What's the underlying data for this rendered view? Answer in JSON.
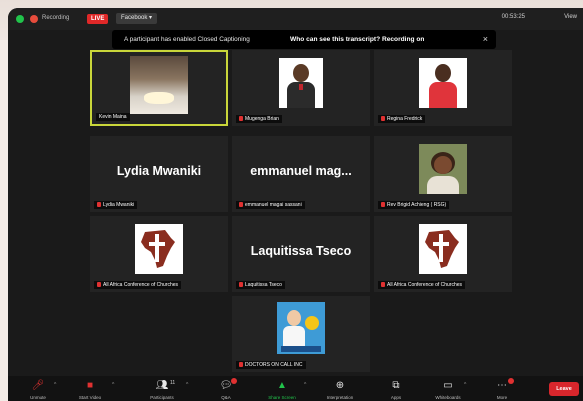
{
  "topbar": {
    "recording_text": "Recording",
    "live_badge": "LIVE",
    "platform": "Facebook ▾",
    "timer": "00:53:25",
    "view_label": "View"
  },
  "caption_banner": {
    "message": "A participant has enabled Closed Captioning",
    "link": "Who can see this transcript? Recording on",
    "close": "×"
  },
  "tiles": [
    {
      "id": "kevin",
      "label": "Kevin Maina"
    },
    {
      "id": "mugenga",
      "label": "Mugenga Brian"
    },
    {
      "id": "regina",
      "label": "Regina Fredrick"
    },
    {
      "id": "lydia",
      "label": "Lydia Mwaniki",
      "big": "Lydia Mwaniki"
    },
    {
      "id": "emmanuel",
      "label": "emmanuel magai sassani",
      "big": "emmanuel  mag..."
    },
    {
      "id": "rev",
      "label": "Rev Brigid Achieng ( RSG)"
    },
    {
      "id": "aacc1",
      "label": "All Africa Conference of Churches"
    },
    {
      "id": "laquitissa",
      "label": "Laquitissa Tseco",
      "big": "Laquitissa Tseco"
    },
    {
      "id": "aacc2",
      "label": "All Africa Conference of Churches"
    },
    {
      "id": "doctors",
      "label": "DOCTORS ON CALL INC"
    }
  ],
  "toolbar": {
    "unmute": "Unmute",
    "start_video": "Start Video",
    "participants": "Participants",
    "participants_count": "11",
    "qa": "Q&A",
    "share_screen": "Share Screen",
    "interpretation": "Interpretation",
    "apps": "Apps",
    "whiteboards": "Whiteboards",
    "more": "More",
    "leave": "Leave"
  },
  "colors": {
    "active_speaker": "#c9d63a",
    "live_red": "#e02828",
    "share_green": "#21c34b",
    "leave_red": "#d8262c"
  }
}
